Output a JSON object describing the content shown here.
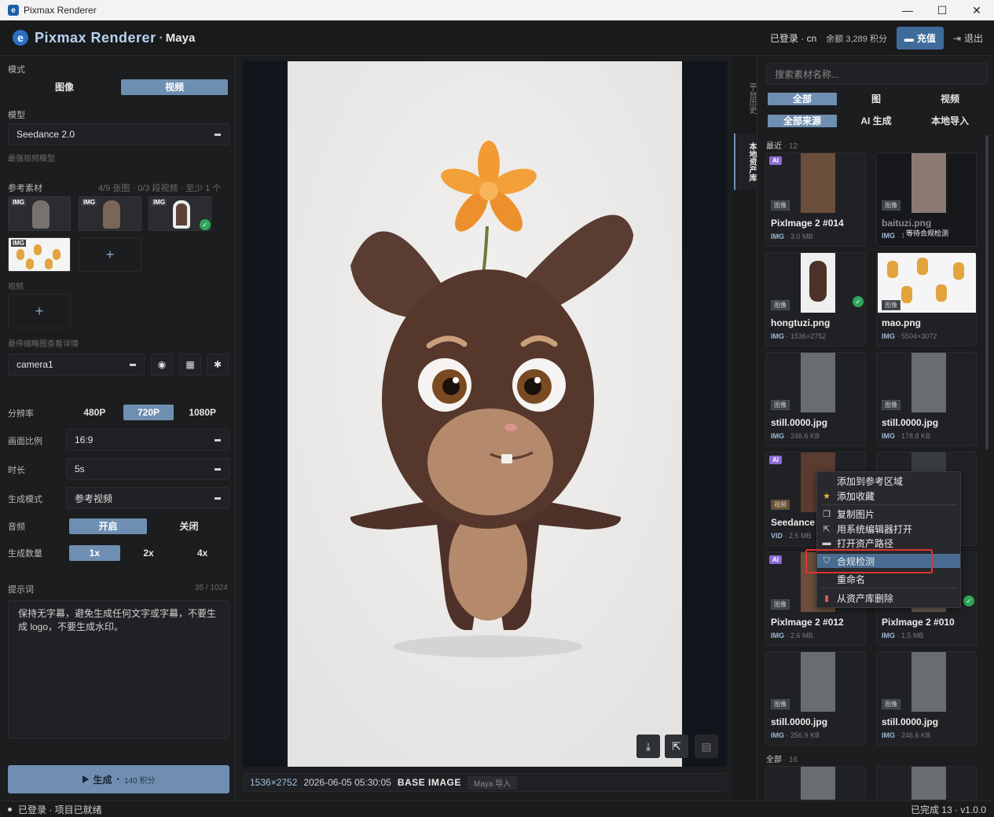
{
  "window": {
    "title": "Pixmax Renderer",
    "controls": [
      "—",
      "☐",
      "✕"
    ]
  },
  "header": {
    "brand": "Pixmax Renderer",
    "host": "Maya",
    "login": "已登录 · cn",
    "balance": "余额 3,289 积分",
    "recharge": "充值",
    "logout": "退出"
  },
  "left": {
    "mode_label": "模式",
    "modes": [
      {
        "label": "图像",
        "on": false
      },
      {
        "label": "视频",
        "on": true
      }
    ],
    "model_label": "模型",
    "model_value": "Seedance 2.0",
    "model_hint": "最强视频模型",
    "ref_label": "参考素材",
    "ref_count": "4/9 张图 · 0/3 段视频 · 至少 1 个",
    "ref_tags": [
      "IMG",
      "IMG",
      "IMG",
      "IMG"
    ],
    "video_label": "视频",
    "hover_hint": "悬停缩略图查看详情",
    "camera_value": "camera1",
    "resolution_label": "分辨率",
    "resolutions": [
      {
        "label": "480P",
        "on": false
      },
      {
        "label": "720P",
        "on": true
      },
      {
        "label": "1080P",
        "on": false
      }
    ],
    "ratio_label": "画面比例",
    "ratio_value": "16:9",
    "duration_label": "时长",
    "duration_value": "5s",
    "genmode_label": "生成模式",
    "genmode_value": "参考视频",
    "audio_label": "音频",
    "audio_opts": [
      {
        "label": "开启",
        "on": true
      },
      {
        "label": "关闭",
        "on": false
      }
    ],
    "count_label": "生成数量",
    "count_opts": [
      {
        "label": "1x",
        "on": true
      },
      {
        "label": "2x",
        "on": false
      },
      {
        "label": "4x",
        "on": false
      }
    ],
    "prompt_label": "提示词",
    "prompt_count": "35 / 1024",
    "prompt_text": "保持无字幕，避免生成任何文字或字幕，不要生成 logo，不要生成水印。",
    "generate_label": "生成",
    "generate_cost": "140 积分"
  },
  "center": {
    "resolution": "1536×2752",
    "timestamp": "2026-06-05 05:30:05",
    "kind": "BASE IMAGE",
    "source": "Maya 导入"
  },
  "tabs": {
    "history": "平台历史",
    "library": "本地资产库"
  },
  "assets": {
    "search_placeholder": "搜索素材名称...",
    "type_filters": [
      {
        "label": "全部",
        "on": true
      },
      {
        "label": "图",
        "on": false
      },
      {
        "label": "视频",
        "on": false
      }
    ],
    "source_filters": [
      {
        "label": "全部来源",
        "on": true
      },
      {
        "label": "AI 生成",
        "on": false
      },
      {
        "label": "本地导入",
        "on": false
      }
    ],
    "recent_label": "最近",
    "recent_count": "12",
    "all_label": "全部",
    "all_count": "16",
    "waiting_text": "等待合规检测",
    "cards": [
      {
        "name": "Pixlmage 2 #014",
        "kind": "IMG",
        "meta": "3.0 MB",
        "ctype": "图像",
        "ai": "AI"
      },
      {
        "name": "baituzi.png",
        "kind": "IMG",
        "meta": "1536×2752",
        "ctype": "图像",
        "ai": ""
      },
      {
        "name": "hongtuzi.png",
        "kind": "IMG",
        "meta": "1536×2752",
        "ctype": "图像",
        "ai": ""
      },
      {
        "name": "mao.png",
        "kind": "IMG",
        "meta": "5504×3072",
        "ctype": "图像",
        "ai": ""
      },
      {
        "name": "still.0000.jpg",
        "kind": "IMG",
        "meta": "246.6 KB",
        "ctype": "图像",
        "ai": ""
      },
      {
        "name": "still.0000.jpg",
        "kind": "IMG",
        "meta": "178.8 KB",
        "ctype": "图像",
        "ai": ""
      },
      {
        "name": "Seedance",
        "kind": "VID",
        "meta": "2.5 MB",
        "ctype": "视频",
        "ai": "AI"
      },
      {
        "name": "",
        "kind": "",
        "meta": "",
        "ctype": "",
        "ai": ""
      },
      {
        "name": "Pixlmage 2 #012",
        "kind": "IMG",
        "meta": "2.6 MB",
        "ctype": "图像",
        "ai": "AI"
      },
      {
        "name": "Pixlmage 2 #010",
        "kind": "IMG",
        "meta": "1.5 MB",
        "ctype": "图像",
        "ai": ""
      },
      {
        "name": "still.0000.jpg",
        "kind": "IMG",
        "meta": "256.9 KB",
        "ctype": "图像",
        "ai": ""
      },
      {
        "name": "still.0000.jpg",
        "kind": "IMG",
        "meta": "246.6 KB",
        "ctype": "图像",
        "ai": ""
      }
    ]
  },
  "context_menu": {
    "items": [
      {
        "label": "添加到参考区域",
        "icon": "plus-icon"
      },
      {
        "label": "添加收藏",
        "icon": "star-icon"
      },
      {
        "label": "复制图片",
        "icon": "copy-icon"
      },
      {
        "label": "用系统编辑器打开",
        "icon": "external-icon"
      },
      {
        "label": "打开资产路径",
        "icon": "folder-icon"
      },
      {
        "label": "合规检测",
        "icon": "shield-icon"
      },
      {
        "label": "重命名",
        "icon": ""
      },
      {
        "label": "从资产库删除",
        "icon": "trash-icon"
      }
    ]
  },
  "status": {
    "left": "已登录 · 项目已就绪",
    "right": "已完成 13 · v1.0.0"
  },
  "colors": {
    "accent": "#6e8fb2",
    "bg": "#1c1d1f",
    "brand": "#b9d3f0",
    "highlight": "#e0342f"
  }
}
